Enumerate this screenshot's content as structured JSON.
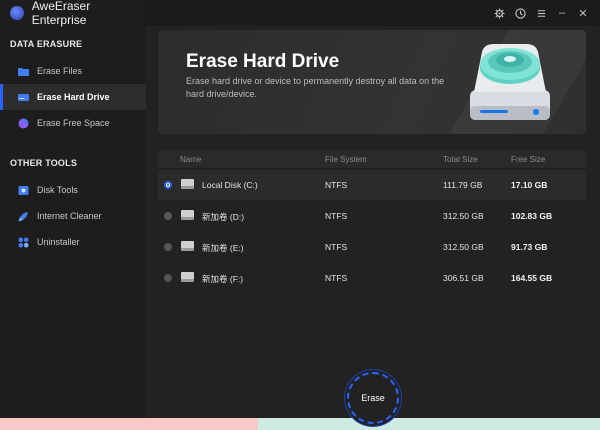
{
  "app": {
    "title": "AweEraser Enterprise"
  },
  "window_controls": {
    "settings_icon": "gear-icon",
    "history_icon": "clock-icon",
    "menu_icon": "menu-icon",
    "minimize": "–",
    "close": "✕"
  },
  "sidebar": {
    "sections": [
      {
        "title": "DATA ERASURE",
        "items": [
          {
            "label": "Erase Files",
            "icon": "folder-icon",
            "active": false
          },
          {
            "label": "Erase Hard Drive",
            "icon": "drive-icon",
            "active": true
          },
          {
            "label": "Erase Free Space",
            "icon": "pie-icon",
            "active": false
          }
        ]
      },
      {
        "title": "OTHER TOOLS",
        "items": [
          {
            "label": "Disk Tools",
            "icon": "disk-tools-icon",
            "active": false
          },
          {
            "label": "Internet Cleaner",
            "icon": "rocket-icon",
            "active": false
          },
          {
            "label": "Uninstaller",
            "icon": "apps-icon",
            "active": false
          }
        ]
      }
    ]
  },
  "hero": {
    "title": "Erase Hard Drive",
    "description": "Erase hard drive or device to permanently destroy all data on the hard drive/device."
  },
  "table": {
    "columns": [
      "Name",
      "File System",
      "Total Size",
      "Free Size"
    ],
    "rows": [
      {
        "name": "Local Disk (C:)",
        "fs": "NTFS",
        "total": "111.79 GB",
        "free": "17.10 GB",
        "selected": true
      },
      {
        "name": "新加卷 (D:)",
        "fs": "NTFS",
        "total": "312.50 GB",
        "free": "102.83 GB",
        "selected": false
      },
      {
        "name": "新加卷 (E:)",
        "fs": "NTFS",
        "total": "312.50 GB",
        "free": "91.73 GB",
        "selected": false
      },
      {
        "name": "新加卷 (F:)",
        "fs": "NTFS",
        "total": "306.51 GB",
        "free": "164.55 GB",
        "selected": false
      }
    ]
  },
  "actions": {
    "erase_label": "Erase"
  },
  "colors": {
    "accent": "#2a62ff",
    "bottom_left": "#f9c9c9",
    "bottom_right": "#cdebe3"
  }
}
